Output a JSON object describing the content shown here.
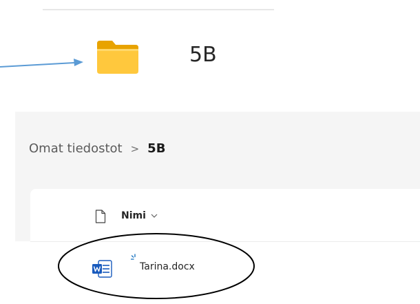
{
  "header": {
    "folder_name": "5B",
    "folder_icon": "folder-icon"
  },
  "breadcrumb": {
    "root_label": "Omat tiedostot",
    "separator": ">",
    "current_label": "5B"
  },
  "file_list": {
    "columns": [
      {
        "icon": "file-type-icon",
        "label": "Nimi",
        "sort_icon": "chevron-down-icon"
      }
    ],
    "rows": [
      {
        "icon": "word-docx-icon",
        "status_icon": "sync-indicator-icon",
        "name": "Tarina.docx"
      }
    ]
  },
  "annotations": {
    "arrow_color": "#5b9bd5",
    "ellipse_color": "#000000"
  },
  "colors": {
    "folder": "#ffc83d",
    "word_blue": "#185abd",
    "pane_background": "#f5f5f5"
  }
}
